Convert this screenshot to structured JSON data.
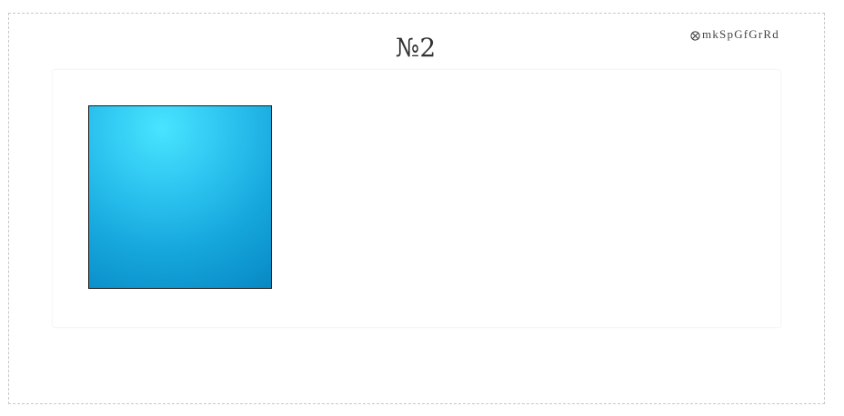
{
  "header": {
    "title": "№2",
    "corner_label": "mkSpGfGrRd",
    "corner_icon": "circled-times-icon"
  },
  "canvas": {
    "shape": "square",
    "gradient_colors": [
      "#48e4ff",
      "#2cc3ef",
      "#15a6dc",
      "#0888c4"
    ],
    "border_color": "#1b1b1b"
  }
}
